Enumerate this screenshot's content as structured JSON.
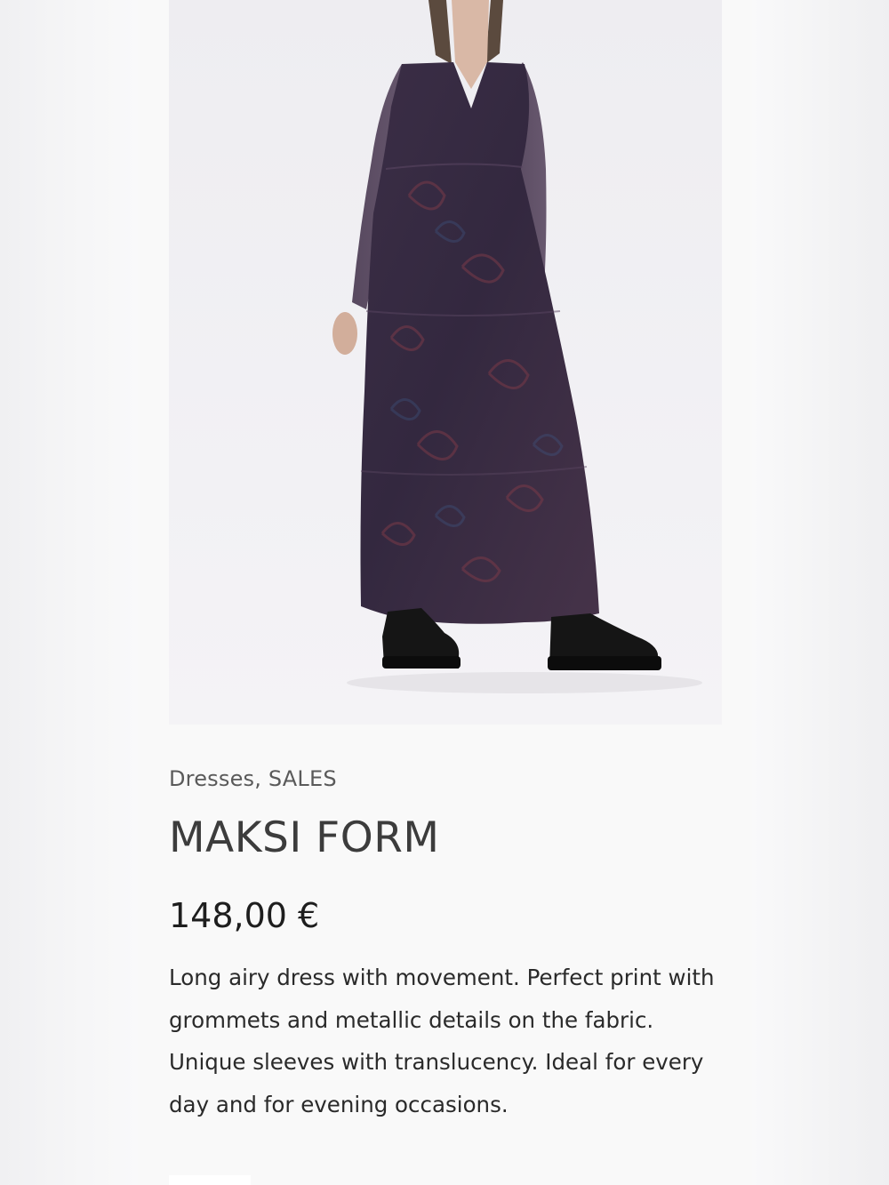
{
  "product": {
    "categories": "Dresses, SALES",
    "title": "MAKSI FORM",
    "price": "148,00 €",
    "description": "Long airy dress with movement. Perfect print with grommets and metallic details on the fabric. Unique sleeves with translucency. Ideal for every day and for evening occasions."
  },
  "colors": {
    "page_background": "#f9f9f9",
    "photo_background": "#eeedf1",
    "dress": "#3a2c42",
    "boots": "#151515",
    "text_primary": "#1e1e1e",
    "text_secondary": "#5a5a5a"
  }
}
